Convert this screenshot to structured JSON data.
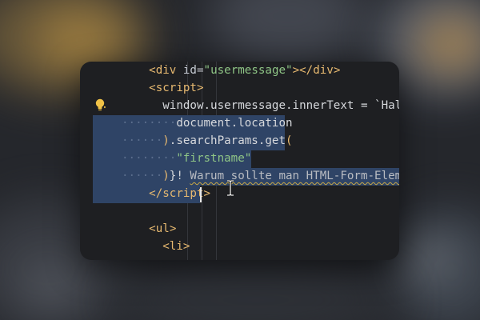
{
  "editor": {
    "lines": [
      {
        "indent": "    ",
        "tokens": [
          {
            "t": "<",
            "c": "tag"
          },
          {
            "t": "div",
            "c": "tag"
          },
          {
            "t": " ",
            "c": "plain"
          },
          {
            "t": "id",
            "c": "attr"
          },
          {
            "t": "=",
            "c": "punct"
          },
          {
            "t": "\"usermessage\"",
            "c": "str"
          },
          {
            "t": "></",
            "c": "tag"
          },
          {
            "t": "div",
            "c": "tag"
          },
          {
            "t": ">",
            "c": "tag"
          }
        ]
      },
      {
        "indent": "    ",
        "tokens": [
          {
            "t": "<",
            "c": "tag"
          },
          {
            "t": "script",
            "c": "tag"
          },
          {
            "t": ">",
            "c": "tag"
          }
        ]
      },
      {
        "indent": "      ",
        "tokens": [
          {
            "t": "window.usermessage.innerText = `Hal",
            "c": "plain"
          }
        ]
      },
      {
        "indent": "········",
        "tokens": [
          {
            "t": "document.location",
            "c": "plain"
          }
        ]
      },
      {
        "indent": "······",
        "tokens": [
          {
            "t": ")",
            "c": "tag"
          },
          {
            "t": ".searchParams.get",
            "c": "plain"
          },
          {
            "t": "(",
            "c": "tag"
          }
        ]
      },
      {
        "indent": "········",
        "tokens": [
          {
            "t": "\"firstname\"",
            "c": "str"
          }
        ]
      },
      {
        "indent": "······",
        "tokens": [
          {
            "t": ")",
            "c": "tag"
          },
          {
            "t": "}! ",
            "c": "plain"
          },
          {
            "t": "Warum sollte man HTML-Form-Eleme",
            "c": "err"
          }
        ]
      },
      {
        "indent": "    ",
        "tokens": [
          {
            "t": "</",
            "c": "tag"
          },
          {
            "t": "script",
            "c": "tag"
          },
          {
            "t": ">",
            "c": "tag"
          }
        ]
      },
      {
        "indent": "",
        "tokens": []
      },
      {
        "indent": "    ",
        "tokens": [
          {
            "t": "<",
            "c": "tag"
          },
          {
            "t": "ul",
            "c": "tag"
          },
          {
            "t": ">",
            "c": "tag"
          }
        ]
      },
      {
        "indent": "      ",
        "tokens": [
          {
            "t": "<",
            "c": "tag"
          },
          {
            "t": "li",
            "c": "tag"
          },
          {
            "t": ">",
            "c": "tag"
          }
        ]
      }
    ]
  },
  "icons": {
    "lightbulb": "lightbulb-icon",
    "cursor": "text-cursor-icon"
  },
  "colors": {
    "editor_bg": "#1e1f22",
    "selection": "#2f4466",
    "tag": "#e7b970",
    "string": "#8fc586",
    "text": "#d6d8dc"
  }
}
